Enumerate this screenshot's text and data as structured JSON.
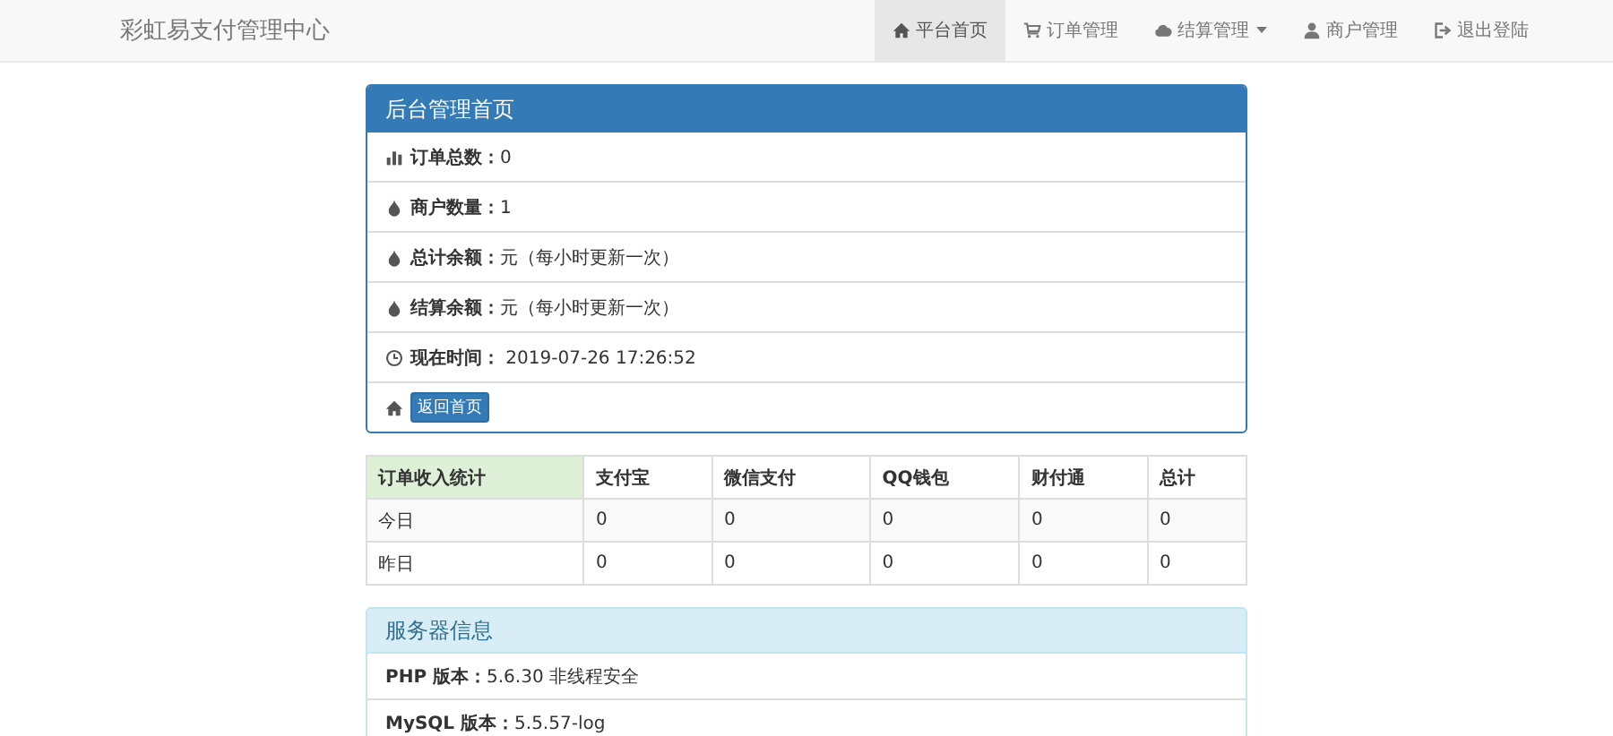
{
  "navbar": {
    "brand": "彩虹易支付管理中心",
    "items": [
      {
        "kind": "home",
        "label": "平台首页",
        "selected": true,
        "dropdown": false
      },
      {
        "kind": "cart",
        "label": "订单管理",
        "selected": false,
        "dropdown": false
      },
      {
        "kind": "cloud",
        "label": "结算管理",
        "selected": false,
        "dropdown": true
      },
      {
        "kind": "user",
        "label": "商户管理",
        "selected": false,
        "dropdown": false
      },
      {
        "kind": "logout",
        "label": "退出登陆",
        "selected": false,
        "dropdown": false
      }
    ]
  },
  "overview": {
    "title": "后台管理首页",
    "rows": [
      {
        "kind": "chart",
        "text": "**订单总数：**0"
      },
      {
        "kind": "drop",
        "text": "**商户数量：**1"
      },
      {
        "kind": "drop",
        "text": "**总计余额：**元（每小时更新一次）"
      },
      {
        "kind": "drop",
        "text": "**结算余额：**元（每小时更新一次）"
      },
      {
        "kind": "clock",
        "text": "**现在时间：** 2019-07-26 17:26:52"
      }
    ],
    "home_button": "返回首页"
  },
  "table": {
    "columns": [
      "订单收入统计",
      "支付宝",
      "微信支付",
      "QQ钱包",
      "财付通",
      "总计"
    ],
    "rows": [
      [
        "今日",
        "0",
        "0",
        "0",
        "0",
        "0"
      ],
      [
        "昨日",
        "0",
        "0",
        "0",
        "0",
        "0"
      ]
    ]
  },
  "server": {
    "title": "服务器信息",
    "rows": [
      "**PHP 版本：**5.6.30 非线程安全",
      "**MySQL 版本：**5.5.57-log"
    ]
  }
}
